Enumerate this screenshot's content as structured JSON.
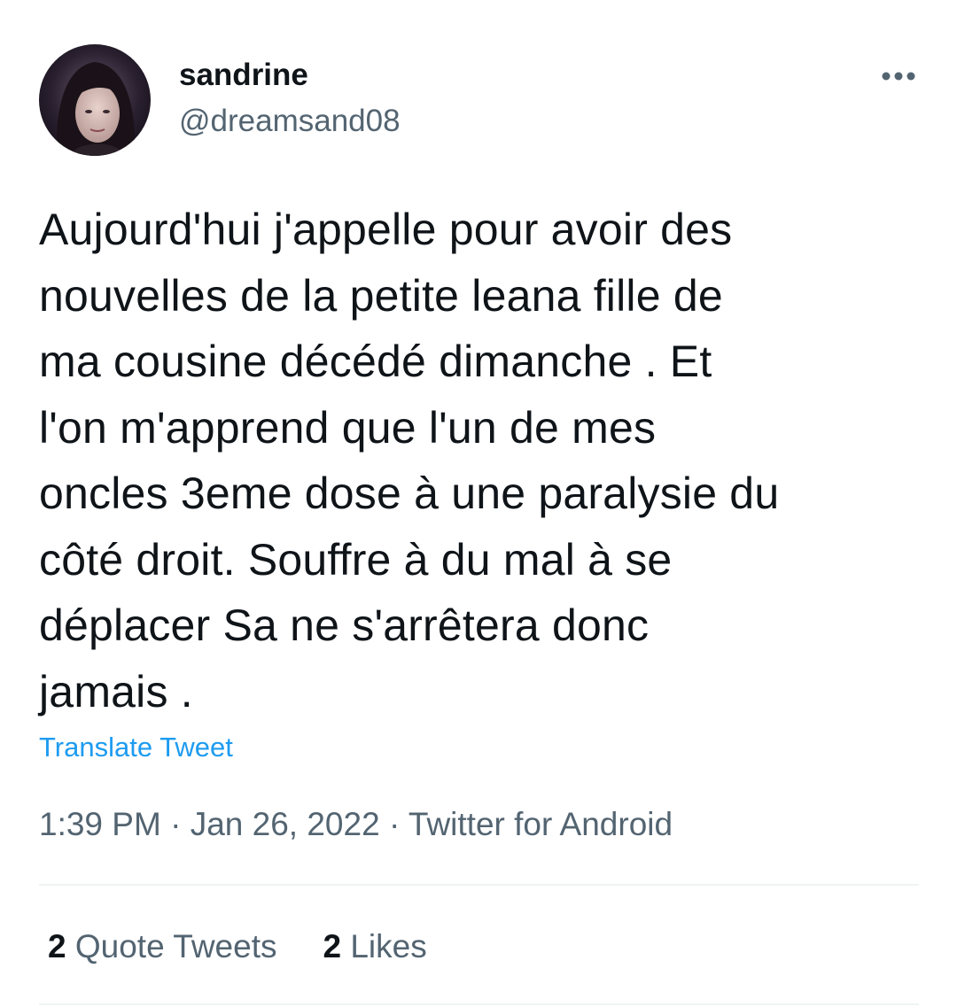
{
  "author": {
    "display_name": "sandrine",
    "handle": "@dreamsand08"
  },
  "tweet": {
    "text": "Aujourd'hui j'appelle pour avoir des\nnouvelles de la petite leana fille  de\nma cousine décédé dimanche . Et\nl'on m'apprend que l'un de mes\noncles 3eme dose à une paralysie du\ncôté droit.  Souffre  à du mal à se\ndéplacer Sa ne s'arrêtera donc\njamais .",
    "translate_label": "Translate Tweet",
    "time": "1:39 PM",
    "date": "Jan 26, 2022",
    "separator": "·",
    "source": "Twitter for Android"
  },
  "stats": {
    "quote_tweets_count": "2",
    "quote_tweets_label": "Quote Tweets",
    "likes_count": "2",
    "likes_label": "Likes"
  },
  "icons": {
    "more": "more-horizontal-icon"
  },
  "colors": {
    "text_primary": "#0f1419",
    "text_secondary": "#536471",
    "link": "#1d9bf0",
    "divider": "#eff3f4"
  }
}
